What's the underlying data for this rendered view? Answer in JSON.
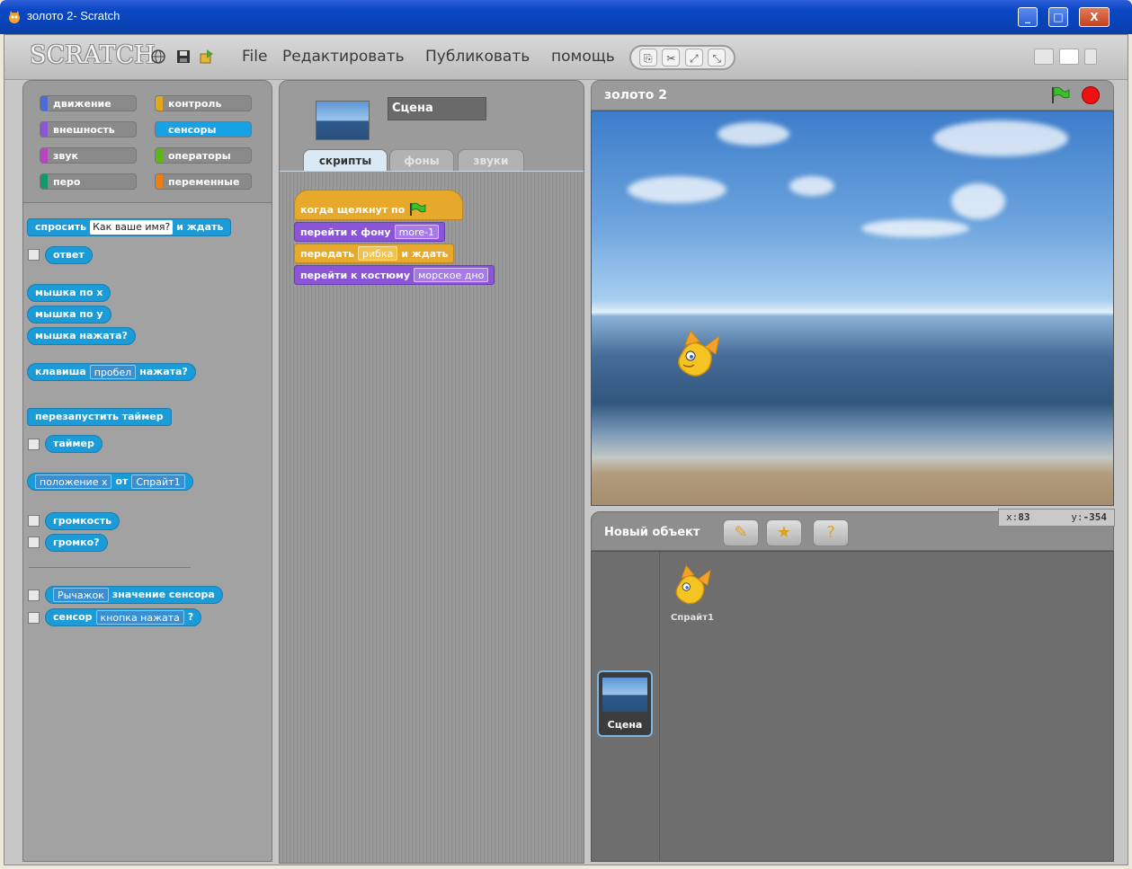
{
  "window": {
    "title": "золото 2- Scratch",
    "controls": [
      "_",
      "□",
      "X"
    ]
  },
  "menubar": {
    "logo": "SCRATCH",
    "menus": [
      "File",
      "Редактировать",
      "Публиковать",
      "помощь"
    ],
    "icons": [
      "globe-icon",
      "save-icon",
      "share-icon"
    ],
    "tools": [
      "stamp-icon",
      "scissors-icon",
      "grow-icon",
      "shrink-icon"
    ]
  },
  "categories": [
    {
      "label": "движение",
      "color": "#4a6cd4"
    },
    {
      "label": "контроль",
      "color": "#e1a91a"
    },
    {
      "label": "внешность",
      "color": "#8a55d7"
    },
    {
      "label": "сенсоры",
      "color": "#18a1e5"
    },
    {
      "label": "звук",
      "color": "#bb42c3"
    },
    {
      "label": "операторы",
      "color": "#5cb712"
    },
    {
      "label": "перо",
      "color": "#0e9a6c"
    },
    {
      "label": "переменные",
      "color": "#ee7d16"
    }
  ],
  "active_category": "сенсоры",
  "palette": {
    "ask_prefix": "спросить",
    "ask_value": "Как ваше имя?",
    "ask_suffix": "и ждать",
    "answer": "ответ",
    "mouse_x": "мышка по x",
    "mouse_y": "мышка по y",
    "mouse_down": "мышка нажата?",
    "key_prefix": "клавиша",
    "key_value": "пробел",
    "key_suffix": "нажата?",
    "reset_timer": "перезапустить таймер",
    "timer": "таймер",
    "attr_value": "положение x",
    "attr_of": "от",
    "attr_sprite": "Спрайт1",
    "loudness": "громкость",
    "loud": "громко?",
    "sensor_value_dd": "Рычажок",
    "sensor_value_label": "значение сенсора",
    "sensor_label": "сенсор",
    "sensor_dd": "кнопка нажата",
    "sensor_suffix": "?"
  },
  "sprite_header": {
    "name": "Сцена",
    "tabs": [
      "скрипты",
      "фоны",
      "звуки"
    ],
    "active_tab": "скрипты"
  },
  "script": {
    "hat": "когда щелкнут по",
    "switch_bg": "перейти к фону",
    "switch_bg_value": "more-1",
    "broadcast": "передать",
    "broadcast_value": "рибка",
    "broadcast_suffix": "и ждать",
    "switch_costume": "перейти к костюму",
    "switch_costume_value": "морское дно"
  },
  "stage": {
    "title": "золото 2"
  },
  "sprites": {
    "new_object_label": "Новый объект",
    "coord_x_label": "x:",
    "coord_x": "83",
    "coord_y_label": "y:",
    "coord_y": "-354",
    "sprite_name": "Спрайт1",
    "stage_name": "Сцена"
  }
}
